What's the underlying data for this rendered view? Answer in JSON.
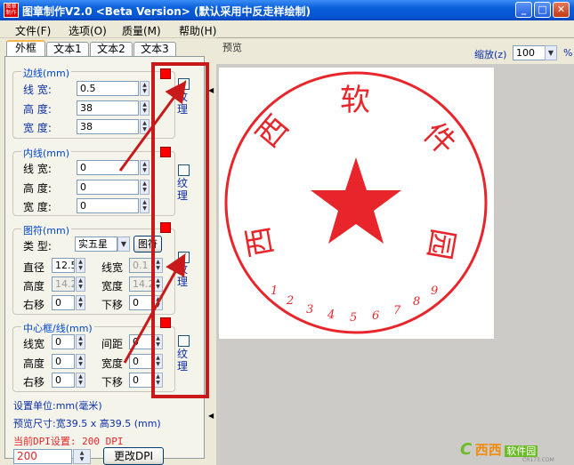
{
  "window": {
    "title": "图章制作V2.0 <Beta Version> (默认采用中反走样绘制)",
    "app_icon_text": "图章制作"
  },
  "menu": [
    {
      "label": "文件(F)"
    },
    {
      "label": "选项(O)"
    },
    {
      "label": "质量(M)"
    },
    {
      "label": "帮助(H)"
    }
  ],
  "tabs": [
    {
      "label": "外框",
      "active": true
    },
    {
      "label": "文本1"
    },
    {
      "label": "文本2"
    },
    {
      "label": "文本3"
    }
  ],
  "outer_line": {
    "title": "边线(mm)",
    "line_width_label": "线 宽:",
    "line_width": "0.5",
    "height_label": "高 度:",
    "height": "38",
    "width_label": "宽 度:",
    "width": "38",
    "texture_label": "纹理",
    "texture_checked": true
  },
  "inner_line": {
    "title": "内线(mm)",
    "line_width_label": "线 宽:",
    "line_width": "0",
    "height_label": "高 度:",
    "height": "0",
    "width_label": "宽 度:",
    "width": "0",
    "texture_label": "纹理",
    "texture_checked": false
  },
  "symbol": {
    "title": "图符(mm)",
    "type_label": "类 型:",
    "type_value": "实五星",
    "symbol_button": "图符",
    "diameter_label": "直径",
    "diameter": "12.5",
    "line_width_label": "线宽",
    "line_width": "0.1",
    "height_label": "高度",
    "height": "14.2",
    "width_label": "宽度",
    "width": "14.2",
    "right_shift_label": "右移",
    "right_shift": "0",
    "down_shift_label": "下移",
    "down_shift": "0",
    "texture_label": "纹理",
    "texture_checked": true
  },
  "center_frame": {
    "title": "中心框/线(mm)",
    "line_width_label": "线宽",
    "line_width": "0",
    "spacing_label": "间距",
    "spacing": "0",
    "height_label": "高度",
    "height": "0",
    "width_label": "宽度",
    "width": "0",
    "right_shift_label": "右移",
    "right_shift": "0",
    "down_shift_label": "下移",
    "down_shift": "0",
    "texture_label": "纹理",
    "texture_checked": false
  },
  "info": {
    "unit": "设置单位:mm(毫米)",
    "preview_size": "预览尺寸:宽39.5 x 高39.5 (mm)",
    "dpi_text": "当前DPI设置: 200 DPI",
    "dpi_value": "200",
    "change_dpi_button": "更改DPI"
  },
  "preview": {
    "label": "预览",
    "zoom_label": "缩放(z)",
    "zoom_value": "100",
    "percent": "%",
    "stamp_top_chars": [
      "西",
      "软",
      "件"
    ],
    "stamp_bottom_chars": [
      "西",
      "园"
    ],
    "stamp_numbers": [
      "1",
      "2",
      "3",
      "4",
      "5",
      "6",
      "7",
      "8",
      "9"
    ]
  },
  "watermark": {
    "brand": "西西",
    "text": "软件园",
    "domain": "CR173.COM"
  },
  "colors": {
    "stamp_red": "#e8252a",
    "annotation_red": "#c81a1a",
    "accent_blue": "#0b2fa8"
  }
}
